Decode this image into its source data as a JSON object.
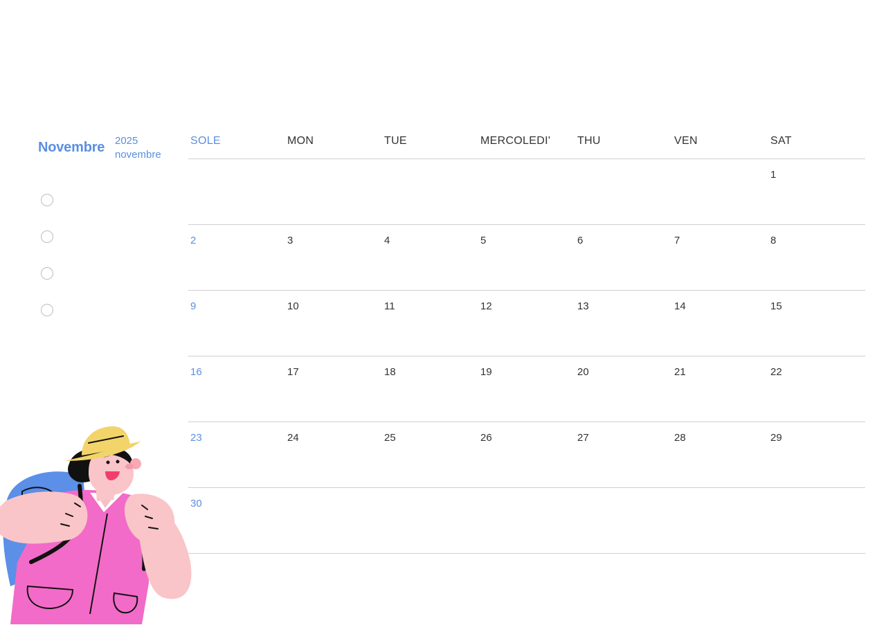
{
  "month": {
    "title": "Novembre",
    "year": "2025",
    "subtitle": "novembre"
  },
  "checklist_count": 4,
  "weekdays": [
    "SOLE",
    "MON",
    "TUE",
    "MERCOLEDI'",
    "THU",
    "VEN",
    "SAT"
  ],
  "weeks": [
    [
      "",
      "",
      "",
      "",
      "",
      "",
      "1"
    ],
    [
      "2",
      "3",
      "4",
      "5",
      "6",
      "7",
      "8"
    ],
    [
      "9",
      "10",
      "11",
      "12",
      "13",
      "14",
      "15"
    ],
    [
      "16",
      "17",
      "18",
      "19",
      "20",
      "21",
      "22"
    ],
    [
      "23",
      "24",
      "25",
      "26",
      "27",
      "28",
      "29"
    ],
    [
      "30",
      "",
      "",
      "",
      "",
      "",
      ""
    ]
  ],
  "colors": {
    "accent": "#5b8fe0",
    "text": "#333333",
    "rule": "#cfcfcf"
  },
  "illustration": {
    "icon": "hiker-girl-illustration"
  }
}
